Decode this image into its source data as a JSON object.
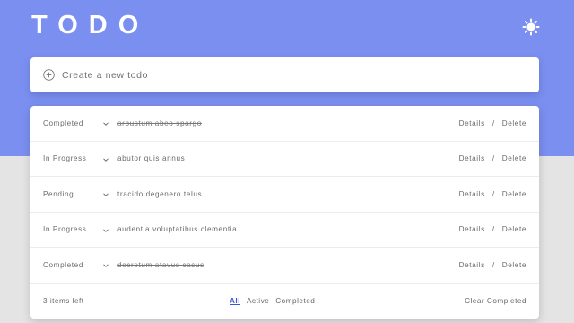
{
  "app": {
    "title": "TODO"
  },
  "create": {
    "placeholder": "Create a new todo"
  },
  "todos": [
    {
      "status": "Completed",
      "text": "arbustum abeo spargo",
      "completed": true
    },
    {
      "status": "In Progress",
      "text": "abutor quis annus",
      "completed": false
    },
    {
      "status": "Pending",
      "text": "tracido degenero telus",
      "completed": false
    },
    {
      "status": "In Progress",
      "text": "audentia voluptatibus clementia",
      "completed": false
    },
    {
      "status": "Completed",
      "text": "decretum atavus casus",
      "completed": true
    }
  ],
  "actions": {
    "details": "Details",
    "separator": "/",
    "delete": "Delete"
  },
  "footer": {
    "items_left": "3 items left",
    "filters": [
      "All",
      "Active",
      "Completed"
    ],
    "active_filter": "All",
    "clear": "Clear Completed"
  },
  "colors": {
    "accent": "#7b8ff0",
    "link_active": "#3a55d6"
  }
}
